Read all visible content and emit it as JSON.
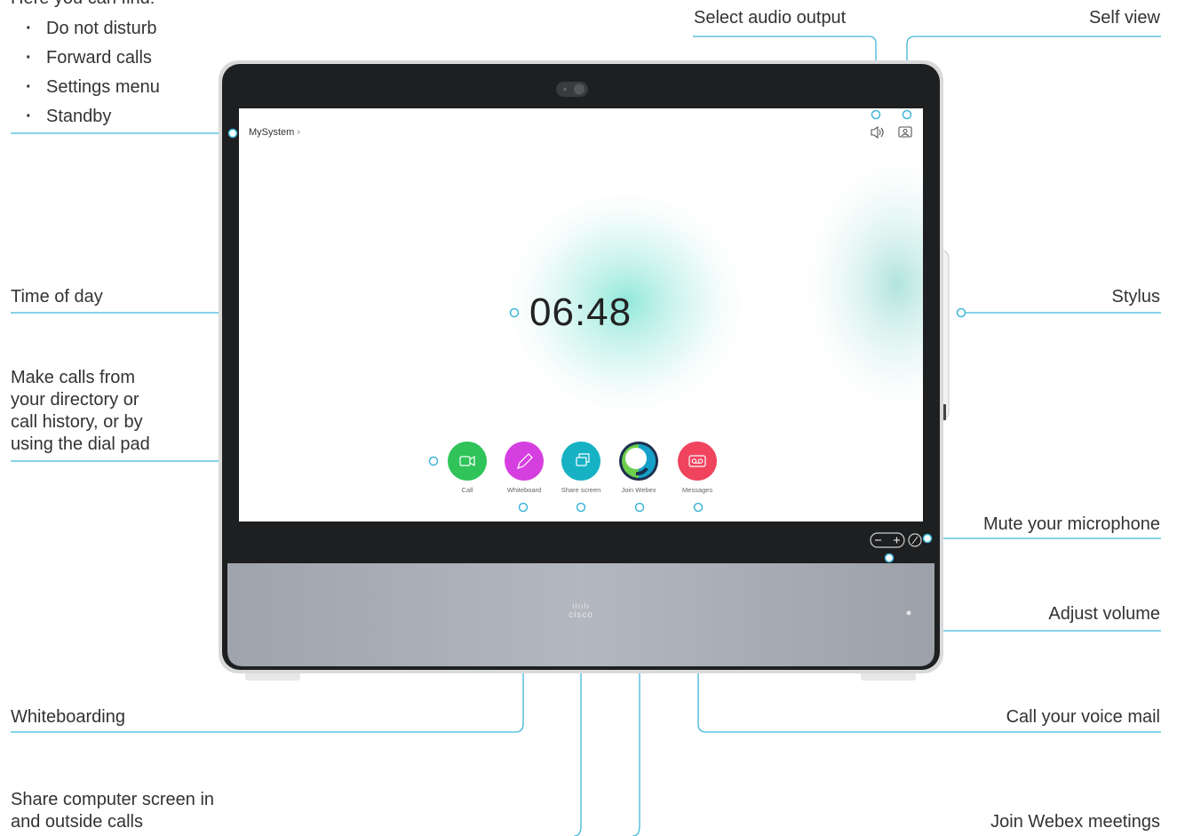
{
  "intro_text": "Here you can find:",
  "home_menu_items": [
    "Do not disturb",
    "Forward calls",
    "Settings menu",
    "Standby"
  ],
  "callouts": {
    "select_audio_output": "Select audio output",
    "self_view": "Self view",
    "time_of_day": "Time of day",
    "stylus": "Stylus",
    "make_calls": [
      "Make calls from",
      "your directory or",
      "call history, or by",
      "using the dial pad"
    ],
    "mute_microphone": "Mute your microphone",
    "adjust_volume": "Adjust volume",
    "whiteboarding": "Whiteboarding",
    "call_voice_mail": "Call your voice mail",
    "share_screen": [
      "Share computer screen in",
      "and outside calls"
    ],
    "join_webex": "Join Webex meetings"
  },
  "screen": {
    "system_name": "MySystem",
    "time": "06:48",
    "buttons": [
      {
        "label": "Call",
        "color": "#2fc35a",
        "icon": "video-camera-icon"
      },
      {
        "label": "Whiteboard",
        "color": "#d63fdf",
        "icon": "pencil-icon"
      },
      {
        "label": "Share screen",
        "color": "#16b2c4",
        "icon": "share-screen-icon"
      },
      {
        "label": "Join Webex",
        "color": "#ffffff",
        "icon": "webex-logo-icon"
      },
      {
        "label": "Messages",
        "color": "#f0435e",
        "icon": "voicemail-icon"
      }
    ]
  },
  "device": {
    "brand": "cisco"
  },
  "colors": {
    "callout_line": "#3fb6d9",
    "bezel": "#1e1f21",
    "speaker": "#a9adb6"
  }
}
